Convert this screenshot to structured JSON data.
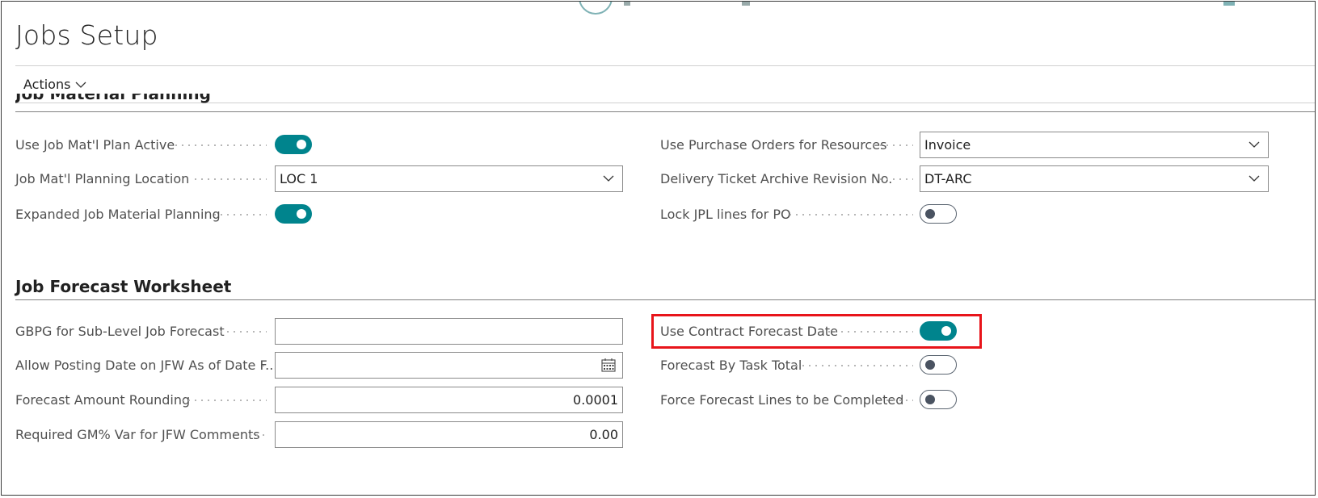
{
  "page": {
    "title": "Jobs Setup"
  },
  "action_bar": {
    "actions_label": "Actions"
  },
  "job_material_planning": {
    "section_title": "Job Material Planning",
    "use_job_matl_plan_active": {
      "label": "Use Job Mat'l Plan Active",
      "value": true
    },
    "job_matl_planning_location": {
      "label": "Job Mat'l Planning Location",
      "value": "LOC 1"
    },
    "expanded_job_material_planning": {
      "label": "Expanded Job Material Planning",
      "value": true
    },
    "use_purchase_orders_for_resources": {
      "label": "Use Purchase Orders for Resources",
      "value": "Invoice"
    },
    "delivery_ticket_archive_revision_no": {
      "label": "Delivery Ticket Archive Revision No.",
      "value": "DT-ARC"
    },
    "lock_jpl_lines_for_po": {
      "label": "Lock JPL lines for PO",
      "value": false
    }
  },
  "job_forecast_worksheet": {
    "section_title": "Job Forecast Worksheet",
    "gbpg_for_sub_level_job_forecast": {
      "label": "GBPG for Sub-Level Job Forecast",
      "value": ""
    },
    "allow_posting_date_on_jfw": {
      "label": "Allow Posting Date on JFW As of Date F...",
      "value": ""
    },
    "forecast_amount_rounding": {
      "label": "Forecast Amount Rounding",
      "value": "0.0001"
    },
    "required_gm_var_for_jfw_comments": {
      "label": "Required GM% Var for JFW Comments",
      "value": "0.00"
    },
    "use_contract_forecast_date": {
      "label": "Use Contract Forecast Date",
      "value": true
    },
    "forecast_by_task_total": {
      "label": "Forecast By Task Total",
      "value": false
    },
    "force_forecast_lines_to_be_completed": {
      "label": "Force Forecast Lines to be Completed",
      "value": false
    }
  },
  "colors": {
    "accent": "#00848d",
    "highlight": "#e8141a"
  },
  "icons": {
    "dropdown": "chevron-down-icon",
    "calendar": "calendar-icon"
  }
}
